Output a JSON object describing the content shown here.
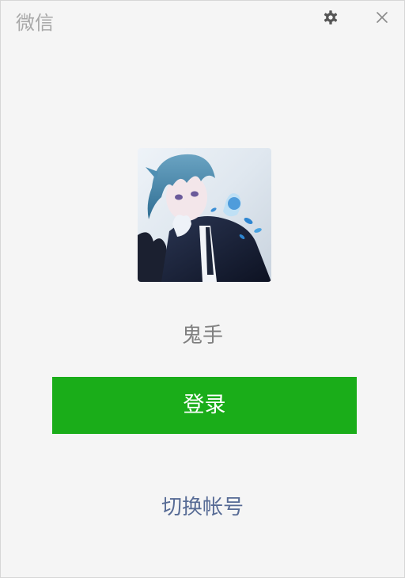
{
  "window": {
    "title": "微信"
  },
  "titlebar": {
    "settings_icon": "gear-icon",
    "close_icon": "close-icon"
  },
  "profile": {
    "avatar": "anime-character-avatar",
    "nickname": "鬼手"
  },
  "actions": {
    "login_label": "登录",
    "switch_account_label": "切换帐号"
  },
  "colors": {
    "background": "#f5f5f5",
    "login_button": "#1aad19",
    "link": "#576b95",
    "title": "#a8a8a8",
    "nickname": "#7f7f7f"
  }
}
